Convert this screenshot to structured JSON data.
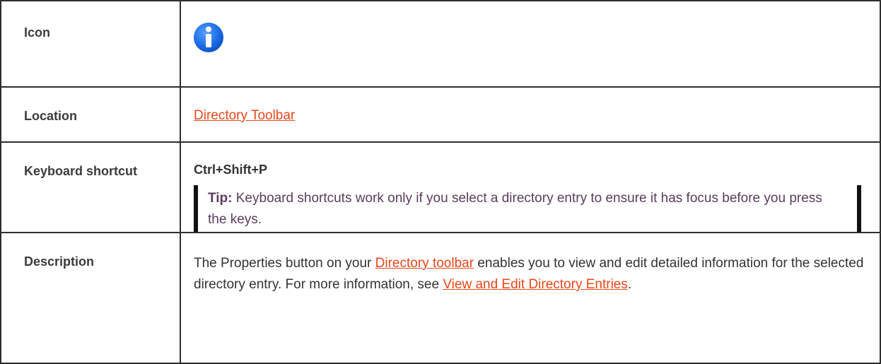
{
  "rows": {
    "icon": {
      "label": "Icon",
      "icon_name": "info-icon",
      "icon_color": "#1e6fe8"
    },
    "location": {
      "label": "Location",
      "link_text": "Directory Toolbar"
    },
    "shortcut": {
      "label": "Keyboard shortcut",
      "keys": "Ctrl+Shift+P",
      "tip_label": "Tip:",
      "tip_text": " Keyboard shortcuts work only if you select a directory entry to ensure it has focus before you press the keys."
    },
    "description": {
      "label": "Description",
      "text_before": "The Properties button on your ",
      "link1_text": "Directory toolbar",
      "text_middle": " enables you to view and edit detailed information for the selected directory entry. For more information, see ",
      "link2_text": "View and Edit Directory Entries",
      "text_after": "."
    }
  },
  "colors": {
    "link": "#e8471a",
    "tip_text": "#5a3d5c",
    "border": "#2e2e2e"
  }
}
